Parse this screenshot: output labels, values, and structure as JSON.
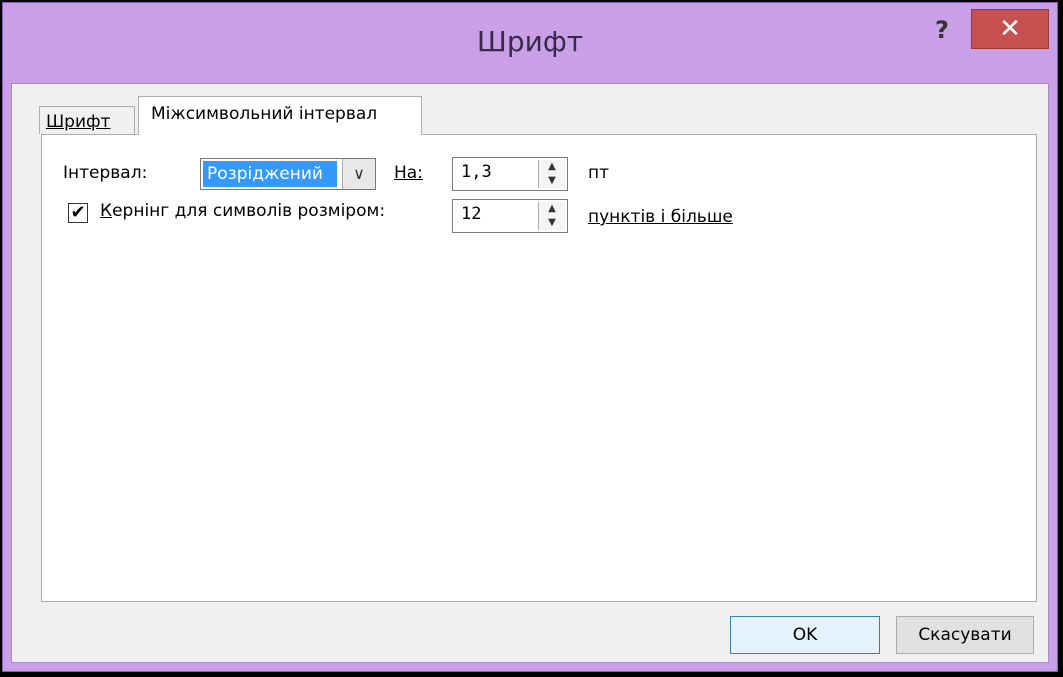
{
  "window": {
    "title": "Шрифт",
    "help_label": "?",
    "close_label": "✕"
  },
  "tabs": [
    {
      "label": "Шрифт",
      "selected": false
    },
    {
      "label": "Міжсимвольний інтервал",
      "selected": true
    }
  ],
  "spacing": {
    "label": "Інтервал:",
    "value": "Розріджений",
    "by_label": "На:",
    "by_value": "1,3",
    "unit": "пт"
  },
  "kerning": {
    "checked": true,
    "check_glyph": "✔",
    "label": "Кернінг для символів розміром:",
    "value": "12",
    "suffix": "пунктів і більше"
  },
  "buttons": {
    "ok": "OK",
    "cancel": "Скасувати"
  },
  "colors": {
    "titlebar": "#c9a0e8",
    "close": "#c75050",
    "selection": "#3399ff"
  }
}
